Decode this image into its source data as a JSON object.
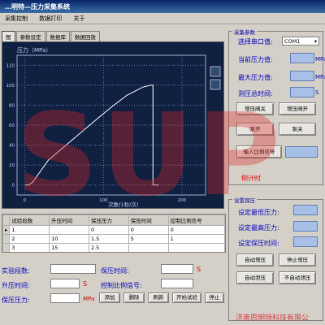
{
  "window": {
    "title": "…明特—压力采集系统"
  },
  "menu": [
    "采集控制",
    "数据打印",
    "关于"
  ],
  "tabs": [
    "图",
    "参数设定",
    "数据库",
    "数据回放"
  ],
  "plot": {
    "label": "压力（MPa）",
    "x_label": "次数(1秒/次)"
  },
  "chart_data": {
    "type": "line",
    "xlabel": "次数(1秒/次)",
    "ylabel": "压力（MPa）",
    "xlim": [
      -10,
      230
    ],
    "ylim": [
      -10,
      130
    ],
    "x_ticks": [
      "0",
      "100",
      "200"
    ],
    "y_ticks": [
      "0",
      "20",
      "40",
      "60",
      "80",
      "100",
      "120"
    ],
    "series": [
      {
        "x": [
          0,
          5,
          10,
          30,
          60,
          90,
          110,
          130,
          150,
          160,
          163,
          163,
          170
        ],
        "y": [
          0,
          0,
          3,
          25,
          45,
          65,
          78,
          90,
          98,
          100,
          100,
          0,
          0
        ]
      }
    ]
  },
  "params": {
    "group_label": "采集参数",
    "port_label": "选择串口值:",
    "port_value": "COM1",
    "current_label": "当前压力值:",
    "max_label": "最大压力值:",
    "duration_label": "测压总时间:",
    "unit_mpa": "MPa",
    "unit_s": "S"
  },
  "buttons": {
    "add_valve_close": "增压阀关",
    "add_valve_open": "增压阀开",
    "pump_open": "泵开",
    "pump_close": "泵关",
    "ratio_input": "输入比例信号",
    "auto_add": "自动增压",
    "stop_add": "停止增压",
    "auto_hold": "自动泄压",
    "no_auto_hold": "不自动泄压"
  },
  "countdown": "倒计时",
  "hold": {
    "group_label": "设置保压",
    "min_label": "设定最低压力:",
    "max_label": "设定最高压力:",
    "time_label": "设定保压时间:"
  },
  "table": {
    "headers": [
      "试验段数",
      "升压时间",
      "保压压力",
      "保压时间",
      "控制比例信号"
    ],
    "rows": [
      [
        "1",
        "",
        "0",
        "0",
        "0"
      ],
      [
        "2",
        "10",
        "1.5",
        "5",
        "1"
      ],
      [
        "3",
        "15",
        "2.5",
        "",
        ""
      ]
    ]
  },
  "form": {
    "segments_label": "实验段数:",
    "rise_time_label": "升压时间:",
    "hold_pressure_label": "保压压力:",
    "hold_time_label": "保压时间:",
    "ratio_label": "控制比例信号:",
    "unit_s": "S",
    "unit_mpa": "MPa",
    "add": "添加",
    "delete": "删除",
    "refresh": "刷新",
    "start": "开始试验",
    "stop": "停止"
  },
  "footer": "济南思明特科技有限公",
  "watermark": "SUP",
  "colors": {
    "plot_bg": "#102040",
    "plot_line": "#ffffff",
    "grid": "#6080b0",
    "axis_text": "#c0d0ff"
  }
}
